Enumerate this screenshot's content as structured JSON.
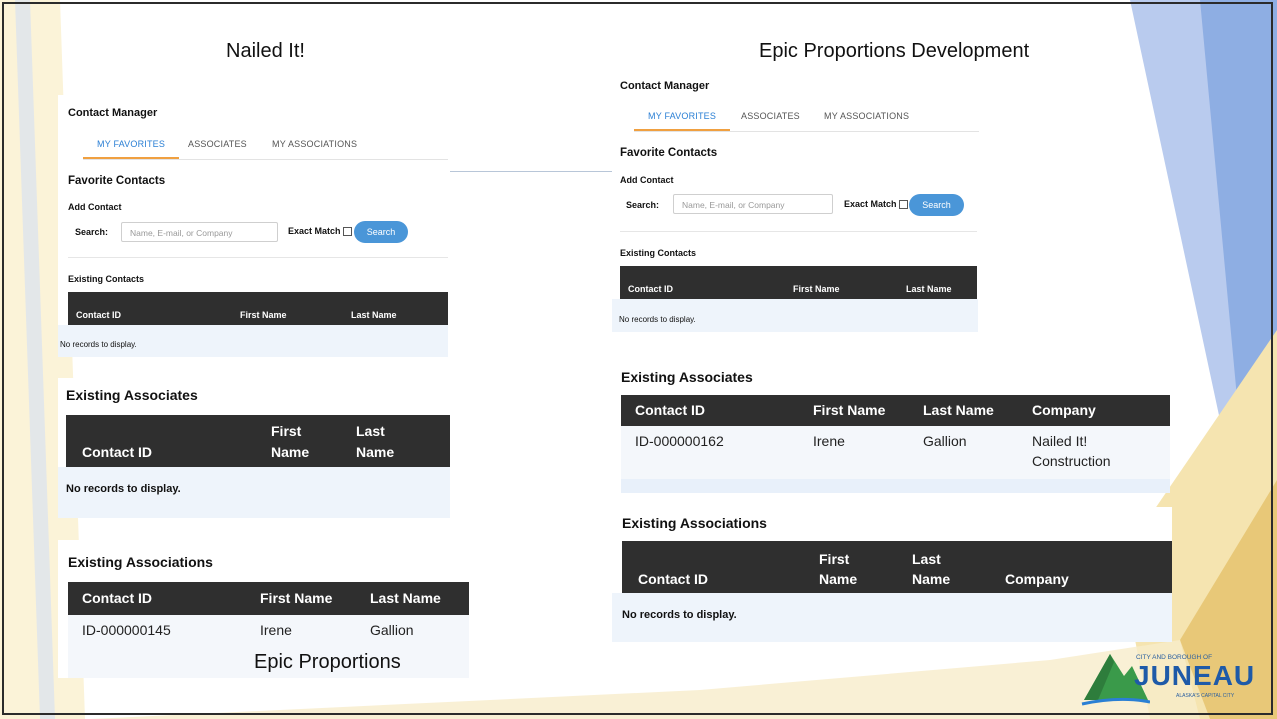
{
  "slide": {
    "left_title": "Nailed It!",
    "right_title": "Epic Proportions Development",
    "bottom_caption": "Epic Proportions",
    "logo": {
      "top_text": "CITY AND BOROUGH OF",
      "name": "JUNEAU",
      "tagline": "ALASKA'S CAPITAL CITY"
    }
  },
  "left_panel": {
    "title": "Contact Manager",
    "tabs": [
      "MY FAVORITES",
      "ASSOCIATES",
      "MY ASSOCIATIONS"
    ],
    "favorite_contacts": "Favorite Contacts",
    "add_contact": "Add Contact",
    "search_label": "Search:",
    "search_placeholder": "Name, E-mail, or Company",
    "exact_match": "Exact Match",
    "search_button": "Search",
    "existing_contacts": "Existing Contacts",
    "contacts_headers": [
      "Contact ID",
      "First Name",
      "Last Name"
    ],
    "no_records": "No records to display."
  },
  "left_associates": {
    "title": "Existing Associates",
    "headers": [
      "Contact ID",
      "First",
      "Name",
      "Last",
      "Name"
    ],
    "no_records": "No records to display."
  },
  "left_associations": {
    "title": "Existing Associations",
    "headers": [
      "Contact ID",
      "First Name",
      "Last Name"
    ],
    "row": [
      "ID-000000145",
      "Irene",
      "Gallion"
    ]
  },
  "right_panel": {
    "title": "Contact Manager",
    "tabs": [
      "MY FAVORITES",
      "ASSOCIATES",
      "MY ASSOCIATIONS"
    ],
    "favorite_contacts": "Favorite Contacts",
    "add_contact": "Add Contact",
    "search_label": "Search:",
    "search_placeholder": "Name, E-mail, or Company",
    "exact_match": "Exact Match",
    "search_button": "Search",
    "existing_contacts": "Existing Contacts",
    "contacts_headers": [
      "Contact ID",
      "First Name",
      "Last Name"
    ],
    "no_records": "No records to display."
  },
  "right_associates": {
    "title": "Existing Associates",
    "headers": [
      "Contact ID",
      "First Name",
      "Last Name",
      "Company"
    ],
    "row": [
      "ID-000000162",
      "Irene",
      "Gallion",
      "Nailed It!",
      "Construction"
    ]
  },
  "right_associations": {
    "title": "Existing Associations",
    "headers": [
      "Contact ID",
      "First",
      "Name",
      "Last",
      "Name",
      "Company"
    ],
    "no_records": "No records to display."
  },
  "colors": {
    "tab_active": "#2a7fd4",
    "tab_underline": "#f0a040",
    "button": "#4a96d8",
    "table_header": "#2f2f2f",
    "table_body": "#eef4fb",
    "deco_blue": "#9fb8e6",
    "deco_yellow": "#f3e3b0"
  }
}
